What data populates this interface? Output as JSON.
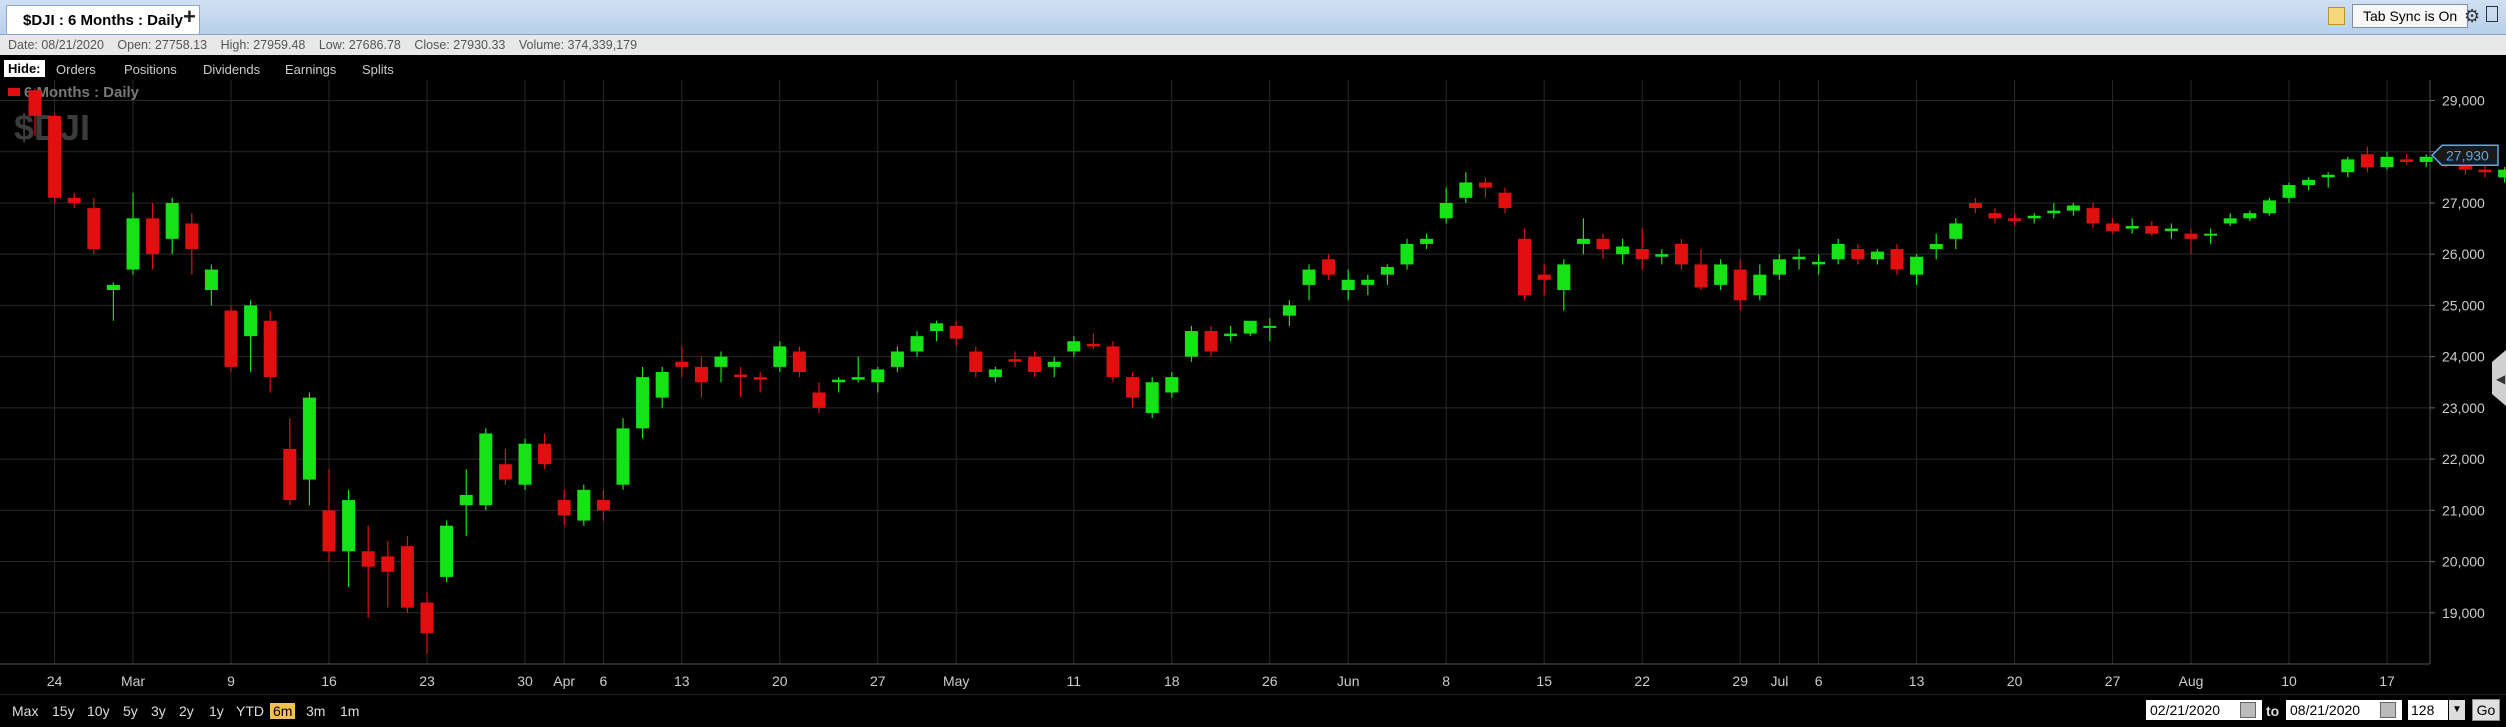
{
  "tab": {
    "title": "$DJI : 6 Months : Daily",
    "add_label": "+"
  },
  "toolbar": {
    "sync_label": "Tab Sync is On"
  },
  "info": {
    "date": "Date: 08/21/2020",
    "open": "Open: 27758.13",
    "high": "High: 27959.48",
    "low": "Low: 27686.78",
    "close": "Close: 27930.33",
    "volume": "Volume: 374,339,179"
  },
  "hide_bar": {
    "hide_label": "Hide:",
    "items": [
      "Orders",
      "Positions",
      "Dividends",
      "Earnings",
      "Splits"
    ]
  },
  "chart_data": {
    "type": "candlestick",
    "title": "6 Months : Daily",
    "watermark": "$DJI",
    "ylim": [
      18000,
      29400
    ],
    "yticks": [
      19000,
      20000,
      21000,
      22000,
      23000,
      24000,
      25000,
      26000,
      27000,
      28000,
      29000
    ],
    "ytick_labels": [
      "19,000",
      "20,000",
      "21,000",
      "22,000",
      "23,000",
      "24,000",
      "25,000",
      "26,000",
      "27,000",
      "28,000",
      "29,000"
    ],
    "last_price_label": "27,930",
    "last_price": 27930,
    "x_labels": [
      {
        "i": 1,
        "label": "24"
      },
      {
        "i": 5,
        "label": "Mar"
      },
      {
        "i": 10,
        "label": "9"
      },
      {
        "i": 15,
        "label": "16"
      },
      {
        "i": 20,
        "label": "23"
      },
      {
        "i": 25,
        "label": "30"
      },
      {
        "i": 27,
        "label": "Apr"
      },
      {
        "i": 29,
        "label": "6"
      },
      {
        "i": 33,
        "label": "13"
      },
      {
        "i": 38,
        "label": "20"
      },
      {
        "i": 43,
        "label": "27"
      },
      {
        "i": 47,
        "label": "May"
      },
      {
        "i": 53,
        "label": "11"
      },
      {
        "i": 58,
        "label": "18"
      },
      {
        "i": 63,
        "label": "26"
      },
      {
        "i": 67,
        "label": "Jun"
      },
      {
        "i": 72,
        "label": "8"
      },
      {
        "i": 77,
        "label": "15"
      },
      {
        "i": 82,
        "label": "22"
      },
      {
        "i": 87,
        "label": "29"
      },
      {
        "i": 89,
        "label": "Jul"
      },
      {
        "i": 91,
        "label": "6"
      },
      {
        "i": 96,
        "label": "13"
      },
      {
        "i": 101,
        "label": "20"
      },
      {
        "i": 106,
        "label": "27"
      },
      {
        "i": 110,
        "label": "Aug"
      },
      {
        "i": 115,
        "label": "10"
      },
      {
        "i": 120,
        "label": "17"
      }
    ],
    "up_color": "#16e316",
    "down_color": "#e01010",
    "ohlc": [
      [
        29200,
        29240,
        28300,
        28700
      ],
      [
        28700,
        28750,
        27000,
        27100
      ],
      [
        27100,
        27200,
        26900,
        27000
      ],
      [
        26900,
        27100,
        26000,
        26100
      ],
      [
        25300,
        25450,
        24700,
        25400
      ],
      [
        25700,
        27200,
        25600,
        26700
      ],
      [
        26700,
        27000,
        25700,
        26000
      ],
      [
        26300,
        27100,
        26000,
        27000
      ],
      [
        26600,
        26800,
        25600,
        26100
      ],
      [
        25300,
        25800,
        25000,
        25700
      ],
      [
        24900,
        25000,
        23700,
        23800
      ],
      [
        24400,
        25100,
        23700,
        25000
      ],
      [
        24700,
        24900,
        23300,
        23600
      ],
      [
        22200,
        22800,
        21100,
        21200
      ],
      [
        21600,
        23300,
        21100,
        23200
      ],
      [
        21000,
        21800,
        20000,
        20200
      ],
      [
        20200,
        21400,
        19500,
        21200
      ],
      [
        20200,
        20700,
        18900,
        19900
      ],
      [
        20100,
        20400,
        19100,
        19800
      ],
      [
        20300,
        20500,
        19000,
        19100
      ],
      [
        19200,
        19400,
        18200,
        18600
      ],
      [
        19700,
        20800,
        19600,
        20700
      ],
      [
        21100,
        21800,
        20500,
        21300
      ],
      [
        21100,
        22600,
        21000,
        22500
      ],
      [
        21900,
        22200,
        21500,
        21600
      ],
      [
        21500,
        22400,
        21400,
        22300
      ],
      [
        22300,
        22500,
        21800,
        21900
      ],
      [
        21200,
        21400,
        20700,
        20900
      ],
      [
        20800,
        21500,
        20700,
        21400
      ],
      [
        21200,
        21400,
        20800,
        21000
      ],
      [
        21500,
        22800,
        21400,
        22600
      ],
      [
        22600,
        23800,
        22400,
        23600
      ],
      [
        23200,
        23800,
        23000,
        23700
      ],
      [
        23900,
        24200,
        23600,
        23800
      ],
      [
        23800,
        24000,
        23200,
        23500
      ],
      [
        23800,
        24100,
        23500,
        24000
      ],
      [
        23650,
        23800,
        23200,
        23600
      ],
      [
        23600,
        23700,
        23300,
        23550
      ],
      [
        23800,
        24300,
        23700,
        24200
      ],
      [
        24100,
        24200,
        23600,
        23700
      ],
      [
        23300,
        23500,
        22900,
        23000
      ],
      [
        23500,
        23600,
        23300,
        23550
      ],
      [
        23550,
        24000,
        23500,
        23600
      ],
      [
        23500,
        23800,
        23300,
        23750
      ],
      [
        23800,
        24200,
        23700,
        24100
      ],
      [
        24100,
        24500,
        24000,
        24400
      ],
      [
        24500,
        24700,
        24300,
        24650
      ],
      [
        24600,
        24700,
        24200,
        24350
      ],
      [
        24100,
        24200,
        23600,
        23700
      ],
      [
        23600,
        23800,
        23500,
        23750
      ],
      [
        23950,
        24100,
        23800,
        23900
      ],
      [
        24000,
        24100,
        23600,
        23700
      ],
      [
        23800,
        24000,
        23600,
        23900
      ],
      [
        24100,
        24400,
        24000,
        24300
      ],
      [
        24250,
        24450,
        24150,
        24200
      ],
      [
        24200,
        24300,
        23500,
        23600
      ],
      [
        23600,
        23700,
        23000,
        23200
      ],
      [
        22900,
        23600,
        22800,
        23500
      ],
      [
        23300,
        23700,
        23200,
        23600
      ],
      [
        24000,
        24600,
        23900,
        24500
      ],
      [
        24500,
        24600,
        24000,
        24100
      ],
      [
        24400,
        24600,
        24300,
        24450
      ],
      [
        24450,
        24700,
        24400,
        24700
      ],
      [
        24600,
        24750,
        24300,
        24600
      ],
      [
        24800,
        25100,
        24600,
        25000
      ],
      [
        25400,
        25800,
        25100,
        25700
      ],
      [
        25900,
        26000,
        25500,
        25600
      ],
      [
        25300,
        25700,
        25100,
        25500
      ],
      [
        25400,
        25600,
        25200,
        25500
      ],
      [
        25600,
        25800,
        25400,
        25750
      ],
      [
        25800,
        26300,
        25700,
        26200
      ],
      [
        26200,
        26400,
        26100,
        26300
      ],
      [
        26700,
        27300,
        26600,
        27000
      ],
      [
        27100,
        27600,
        27000,
        27400
      ],
      [
        27400,
        27500,
        27100,
        27300
      ],
      [
        27200,
        27300,
        26800,
        26900
      ],
      [
        26300,
        26500,
        25100,
        25200
      ],
      [
        25600,
        25800,
        25200,
        25500
      ],
      [
        25300,
        25900,
        24900,
        25800
      ],
      [
        26200,
        26700,
        26000,
        26300
      ],
      [
        26300,
        26400,
        25900,
        26100
      ],
      [
        26000,
        26300,
        25800,
        26150
      ],
      [
        26100,
        26500,
        25700,
        25900
      ],
      [
        25950,
        26100,
        25800,
        26000
      ],
      [
        26200,
        26300,
        25700,
        25800
      ],
      [
        25800,
        26100,
        25300,
        25350
      ],
      [
        25400,
        25900,
        25300,
        25800
      ],
      [
        25700,
        25900,
        24900,
        25100
      ],
      [
        25200,
        25800,
        25100,
        25600
      ],
      [
        25600,
        26000,
        25500,
        25900
      ],
      [
        25900,
        26100,
        25700,
        25950
      ],
      [
        25800,
        26000,
        25600,
        25850
      ],
      [
        25900,
        26300,
        25800,
        26200
      ],
      [
        26100,
        26200,
        25800,
        25900
      ],
      [
        25900,
        26100,
        25800,
        26050
      ],
      [
        26100,
        26200,
        25600,
        25700
      ],
      [
        25600,
        26000,
        25400,
        25950
      ],
      [
        26100,
        26400,
        25900,
        26200
      ],
      [
        26300,
        26700,
        26100,
        26600
      ],
      [
        27000,
        27100,
        26800,
        26900
      ],
      [
        26800,
        26900,
        26600,
        26700
      ],
      [
        26700,
        26800,
        26550,
        26650
      ],
      [
        26700,
        26800,
        26600,
        26750
      ],
      [
        26800,
        27000,
        26700,
        26850
      ],
      [
        26850,
        27000,
        26750,
        26950
      ],
      [
        26900,
        27000,
        26500,
        26600
      ],
      [
        26600,
        26700,
        26400,
        26450
      ],
      [
        26500,
        26700,
        26400,
        26550
      ],
      [
        26550,
        26650,
        26350,
        26400
      ],
      [
        26450,
        26600,
        26300,
        26500
      ],
      [
        26400,
        26500,
        26000,
        26300
      ],
      [
        26400,
        26500,
        26200,
        26400
      ],
      [
        26600,
        26800,
        26550,
        26700
      ],
      [
        26700,
        26850,
        26650,
        26800
      ],
      [
        26800,
        27100,
        26750,
        27050
      ],
      [
        27100,
        27400,
        27000,
        27350
      ],
      [
        27350,
        27500,
        27250,
        27450
      ],
      [
        27500,
        27600,
        27300,
        27550
      ],
      [
        27600,
        27900,
        27500,
        27850
      ],
      [
        27950,
        28100,
        27600,
        27700
      ],
      [
        27700,
        28000,
        27650,
        27900
      ],
      [
        27850,
        27950,
        27750,
        27800
      ],
      [
        27800,
        27950,
        27700,
        27900
      ],
      [
        27900,
        27950,
        27700,
        27750
      ],
      [
        27750,
        27850,
        27550,
        27650
      ],
      [
        27650,
        27800,
        27500,
        27600
      ],
      [
        27500,
        27700,
        27400,
        27650
      ],
      [
        27750,
        27950,
        27700,
        27930
      ]
    ]
  },
  "range_buttons": [
    "Max",
    "15y",
    "10y",
    "5y",
    "3y",
    "2y",
    "1y",
    "YTD",
    "6m",
    "3m",
    "1m"
  ],
  "selected_range": "6m",
  "date_from": "02/21/2020",
  "to_label": "to",
  "date_to": "08/21/2020",
  "bars_value": "128",
  "go_label": "Go",
  "colors": {
    "up": "#16e316",
    "down": "#e01010",
    "grid": "#2a2a2a",
    "tab_bg": "#c4d7ee",
    "selected_range": "#f2c14e"
  }
}
